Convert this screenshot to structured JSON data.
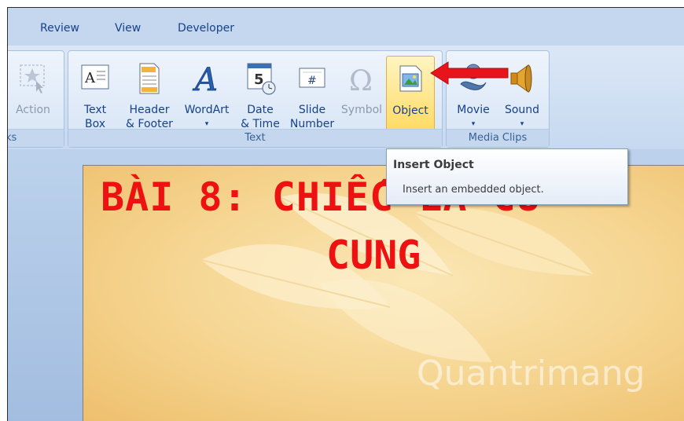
{
  "tabs": [
    "Review",
    "View",
    "Developer"
  ],
  "groups": {
    "links": {
      "partial_label": "ks",
      "action_label": "Action"
    },
    "text": {
      "label": "Text",
      "buttons": {
        "text_box": [
          "Text",
          "Box"
        ],
        "header_footer": [
          "Header",
          "& Footer"
        ],
        "wordart": [
          "WordArt",
          "▾"
        ],
        "date_time": [
          "Date",
          "& Time"
        ],
        "slide_number": [
          "Slide",
          "Number"
        ],
        "symbol": "Symbol",
        "object": "Object"
      }
    },
    "media": {
      "label": "Media Clips",
      "buttons": {
        "movie": [
          "Movie",
          "▾"
        ],
        "sound": [
          "Sound",
          "▾"
        ]
      }
    }
  },
  "tooltip": {
    "title": "Insert Object",
    "description": "Insert an embedded object."
  },
  "slide": {
    "title_line1": "BÀI 8: CHIẾC LÁ CU",
    "title_line2": "CUNG"
  },
  "watermark": "Quantrimang",
  "colors": {
    "ribbon_text": "#15428b",
    "highlight": "#ffd960",
    "arrow": "#e8141c",
    "slide_title": "#ee1111"
  }
}
